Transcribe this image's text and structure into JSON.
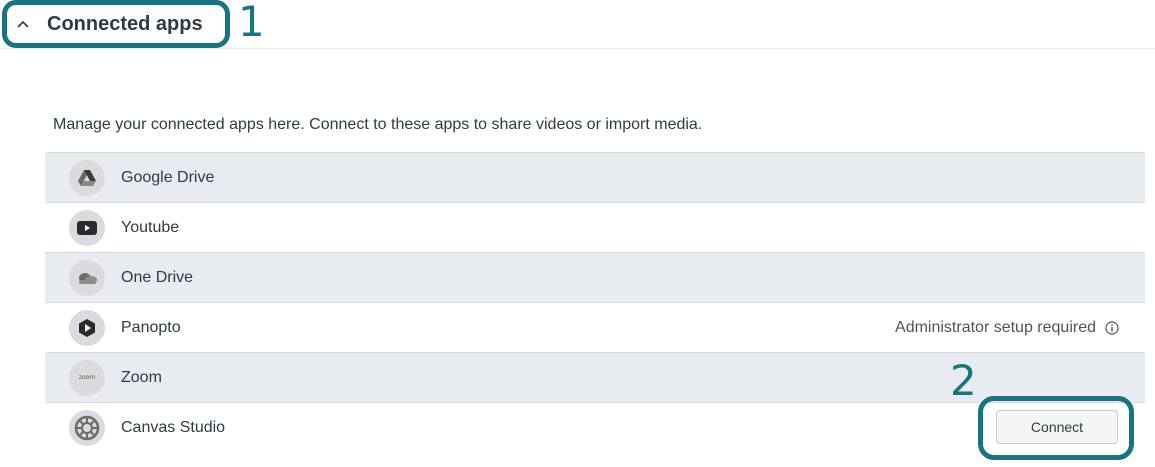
{
  "header": {
    "title": "Connected apps",
    "annotation_1": "1"
  },
  "description": "Manage your connected apps here. Connect to these apps to share videos or import media.",
  "apps": [
    {
      "name": "Google Drive",
      "icon": "google-drive-icon",
      "status": ""
    },
    {
      "name": "Youtube",
      "icon": "youtube-icon",
      "status": ""
    },
    {
      "name": "One Drive",
      "icon": "onedrive-icon",
      "status": ""
    },
    {
      "name": "Panopto",
      "icon": "panopto-icon",
      "status": "Administrator setup required"
    },
    {
      "name": "Zoom",
      "icon": "zoom-icon",
      "icon_text": "zoom",
      "status": ""
    },
    {
      "name": "Canvas Studio",
      "icon": "canvas-studio-icon",
      "status": ""
    }
  ],
  "connect_button_label": "Connect",
  "annotation_2": "2",
  "colors": {
    "accent": "#1a7480",
    "row_shade": "#e8ebef",
    "text": "#2d3b45"
  }
}
